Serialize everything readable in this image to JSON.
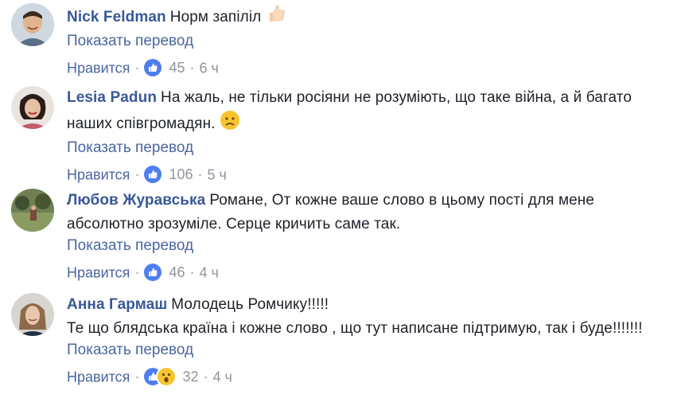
{
  "comments": [
    {
      "author": "Nick Feldman",
      "text": "Норм запіліл",
      "emoji": "thumbs-up",
      "translate": "Показать перевод",
      "like": "Нравится",
      "count": "45",
      "time": "6 ч",
      "reactions": [
        "like"
      ]
    },
    {
      "author": "Lesia Padun",
      "text": "На жаль, не тільки росіяни не розуміють, що таке війна, а й багато наших співгромадян.",
      "emoji": "worried-face",
      "translate": "Показать перевод",
      "like": "Нравится",
      "count": "106",
      "time": "5 ч",
      "reactions": [
        "like"
      ]
    },
    {
      "author": "Любов Журавська",
      "text": "Романе, От кожне ваше слово в цьому пості для мене абсолютно зрозуміле. Серце кричить саме так.",
      "translate": "Показать перевод",
      "like": "Нравится",
      "count": "46",
      "time": "4 ч",
      "reactions": [
        "like"
      ]
    },
    {
      "author": "Анна Гармаш",
      "text_line1": "Молодець Ромчику!!!!!",
      "text_line2": "Те що блядська країна і кожне слово , що тут написане підтримую, так і буде!!!!!!!",
      "translate": "Показать перевод",
      "like": "Нравится",
      "count": "32",
      "time": "4 ч",
      "reactions": [
        "like",
        "wow"
      ]
    }
  ],
  "colors": {
    "author": "#385898",
    "link": "#4a66a0",
    "muted": "#90949c",
    "like_blue": "#4d7ef0",
    "wow_yellow": "#f7c42e"
  }
}
